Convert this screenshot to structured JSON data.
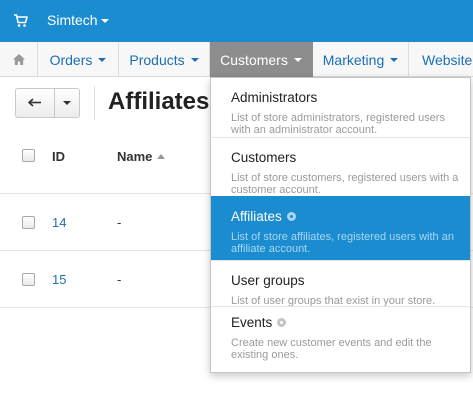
{
  "topbar": {
    "cart_icon": "shopping-cart-icon",
    "store_name": "Simtech",
    "color": "#1a8ccf"
  },
  "nav": {
    "home_icon": "home-icon",
    "items": [
      {
        "label": "Orders"
      },
      {
        "label": "Products"
      },
      {
        "label": "Customers",
        "active": true
      },
      {
        "label": "Marketing"
      },
      {
        "label": "Website"
      }
    ]
  },
  "toolbar": {
    "back_icon": "arrow-back-icon",
    "title": "Affiliates"
  },
  "table": {
    "columns": {
      "id": "ID",
      "name": "Name"
    },
    "rows": [
      {
        "id": "14",
        "name": "-"
      },
      {
        "id": "15",
        "name": "-"
      }
    ]
  },
  "customers_menu": {
    "items": [
      {
        "title": "Administrators",
        "desc": "List of store administrators, registered users with an administrator account."
      },
      {
        "title": "Customers",
        "desc": "List of store customers, registered users with a customer account."
      },
      {
        "title": "Affiliates",
        "desc": "List of store affiliates, registered users with an affiliate account.",
        "selected": true
      },
      {
        "title": "User groups",
        "desc": "List of user groups that exist in your store."
      },
      {
        "title": "Events",
        "desc": "Create new customer events and edit the existing ones."
      }
    ]
  }
}
